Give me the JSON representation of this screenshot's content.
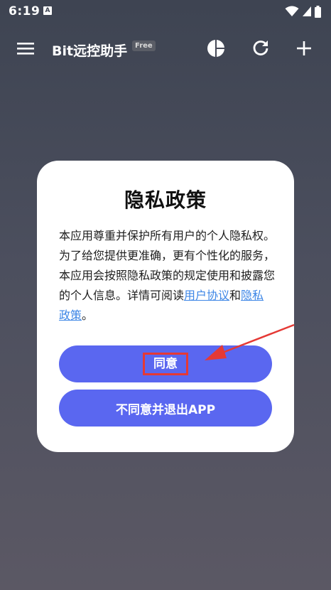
{
  "status_bar": {
    "time": "6:19",
    "notification_icon_letter": "A",
    "icons": [
      "wifi-icon",
      "signal-icon",
      "battery-icon"
    ]
  },
  "toolbar": {
    "title": "Bit远控助手",
    "badge": "Free",
    "actions": [
      "pie-chart-icon",
      "refresh-icon",
      "add-icon"
    ]
  },
  "dialog": {
    "title": "隐私政策",
    "body_prefix": "本应用尊重并保护所有用户的个人隐私权。为了给您提供更准确，更有个性化的服务，本应用会按照隐私政策的规定使用和披露您的个人信息。详情可阅读",
    "link_user_agreement": "用户协议",
    "body_and": "和",
    "link_privacy_policy": "隐私政策",
    "body_suffix": "。",
    "agree_button": "同意",
    "decline_button": "不同意并退出APP"
  },
  "colors": {
    "primary_button": "#5a67f0",
    "link": "#3d86e6",
    "annotation": "#e53935"
  }
}
